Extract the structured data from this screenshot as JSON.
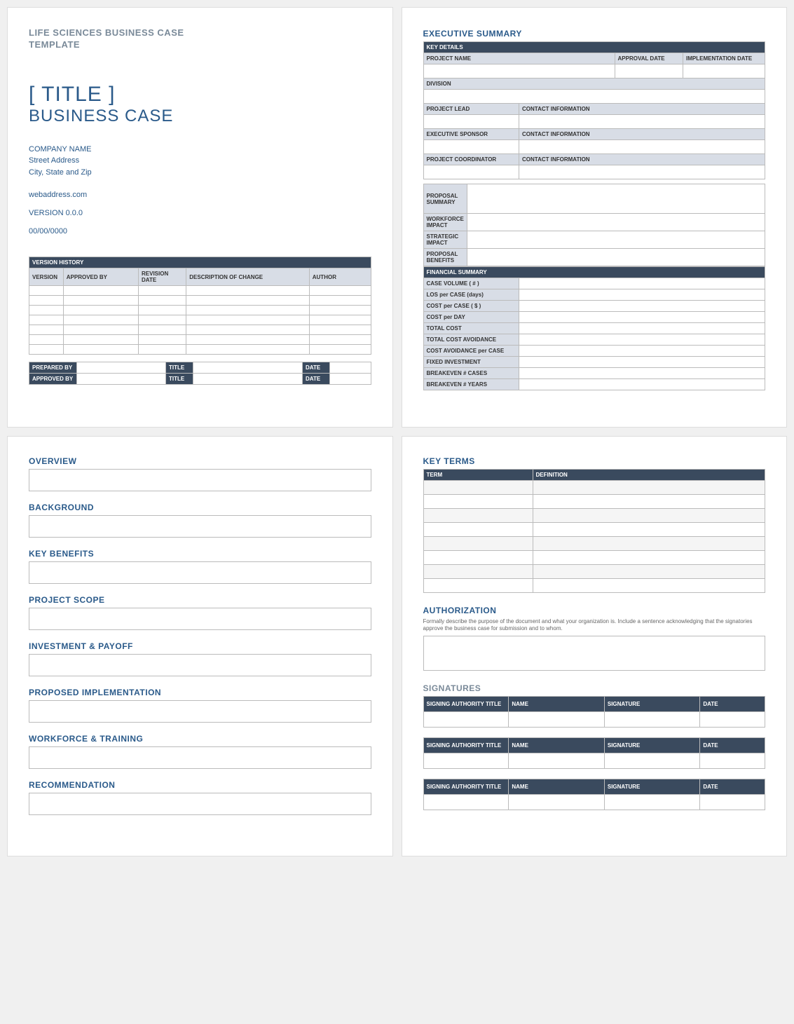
{
  "page1": {
    "template_label_l1": "LIFE SCIENCES BUSINESS CASE",
    "template_label_l2": "TEMPLATE",
    "title": "[ TITLE ]",
    "subtitle": "BUSINESS CASE",
    "company": "COMPANY NAME",
    "street": "Street Address",
    "city": "City, State and Zip",
    "web": "webaddress.com",
    "version": "VERSION 0.0.0",
    "date": "00/00/0000",
    "vh_title": "VERSION HISTORY",
    "vh_cols": {
      "version": "VERSION",
      "approved": "APPROVED BY",
      "revdate": "REVISION DATE",
      "desc": "DESCRIPTION OF CHANGE",
      "author": "AUTHOR"
    },
    "sign": {
      "prepared": "PREPARED BY",
      "approved": "APPROVED BY",
      "title": "TITLE",
      "date": "DATE"
    }
  },
  "page2": {
    "heading": "EXECUTIVE SUMMARY",
    "key_details": "KEY DETAILS",
    "projname": "PROJECT NAME",
    "approval": "APPROVAL DATE",
    "impl": "IMPLEMENTATION DATE",
    "division": "DIVISION",
    "lead": "PROJECT LEAD",
    "contact": "CONTACT INFORMATION",
    "sponsor": "EXECUTIVE SPONSOR",
    "coord": "PROJECT COORDINATOR",
    "prop_summary": "PROPOSAL SUMMARY",
    "workforce": "WORKFORCE IMPACT",
    "strategic": "STRATEGIC IMPACT",
    "benefits": "PROPOSAL BENEFITS",
    "fin_summary": "FINANCIAL SUMMARY",
    "fin": {
      "casevol": "CASE VOLUME ( # )",
      "los": "LOS per CASE (days)",
      "costcase": "COST per CASE ( $ )",
      "costday": "COST per DAY",
      "total": "TOTAL COST",
      "avoid": "TOTAL COST AVOIDANCE",
      "avoidcase": "COST AVOIDANCE per CASE",
      "fixed": "FIXED INVESTMENT",
      "becases": "BREAKEVEN # CASES",
      "beyears": "BREAKEVEN # YEARS"
    }
  },
  "page3": {
    "overview": "OVERVIEW",
    "background": "BACKGROUND",
    "benefits": "KEY BENEFITS",
    "scope": "PROJECT SCOPE",
    "invest": "INVESTMENT & PAYOFF",
    "impl": "PROPOSED IMPLEMENTATION",
    "workforce": "WORKFORCE & TRAINING",
    "recommend": "RECOMMENDATION"
  },
  "page4": {
    "keyterms": "KEY TERMS",
    "term": "TERM",
    "definition": "DEFINITION",
    "auth": "AUTHORIZATION",
    "auth_note": "Formally describe the purpose of the document and what your organization is. Include a sentence acknowledging that the signatories approve the business case for submission and to whom.",
    "signatures": "SIGNATURES",
    "sig_cols": {
      "title": "SIGNING AUTHORITY TITLE",
      "name": "NAME",
      "signature": "SIGNATURE",
      "date": "DATE"
    }
  }
}
